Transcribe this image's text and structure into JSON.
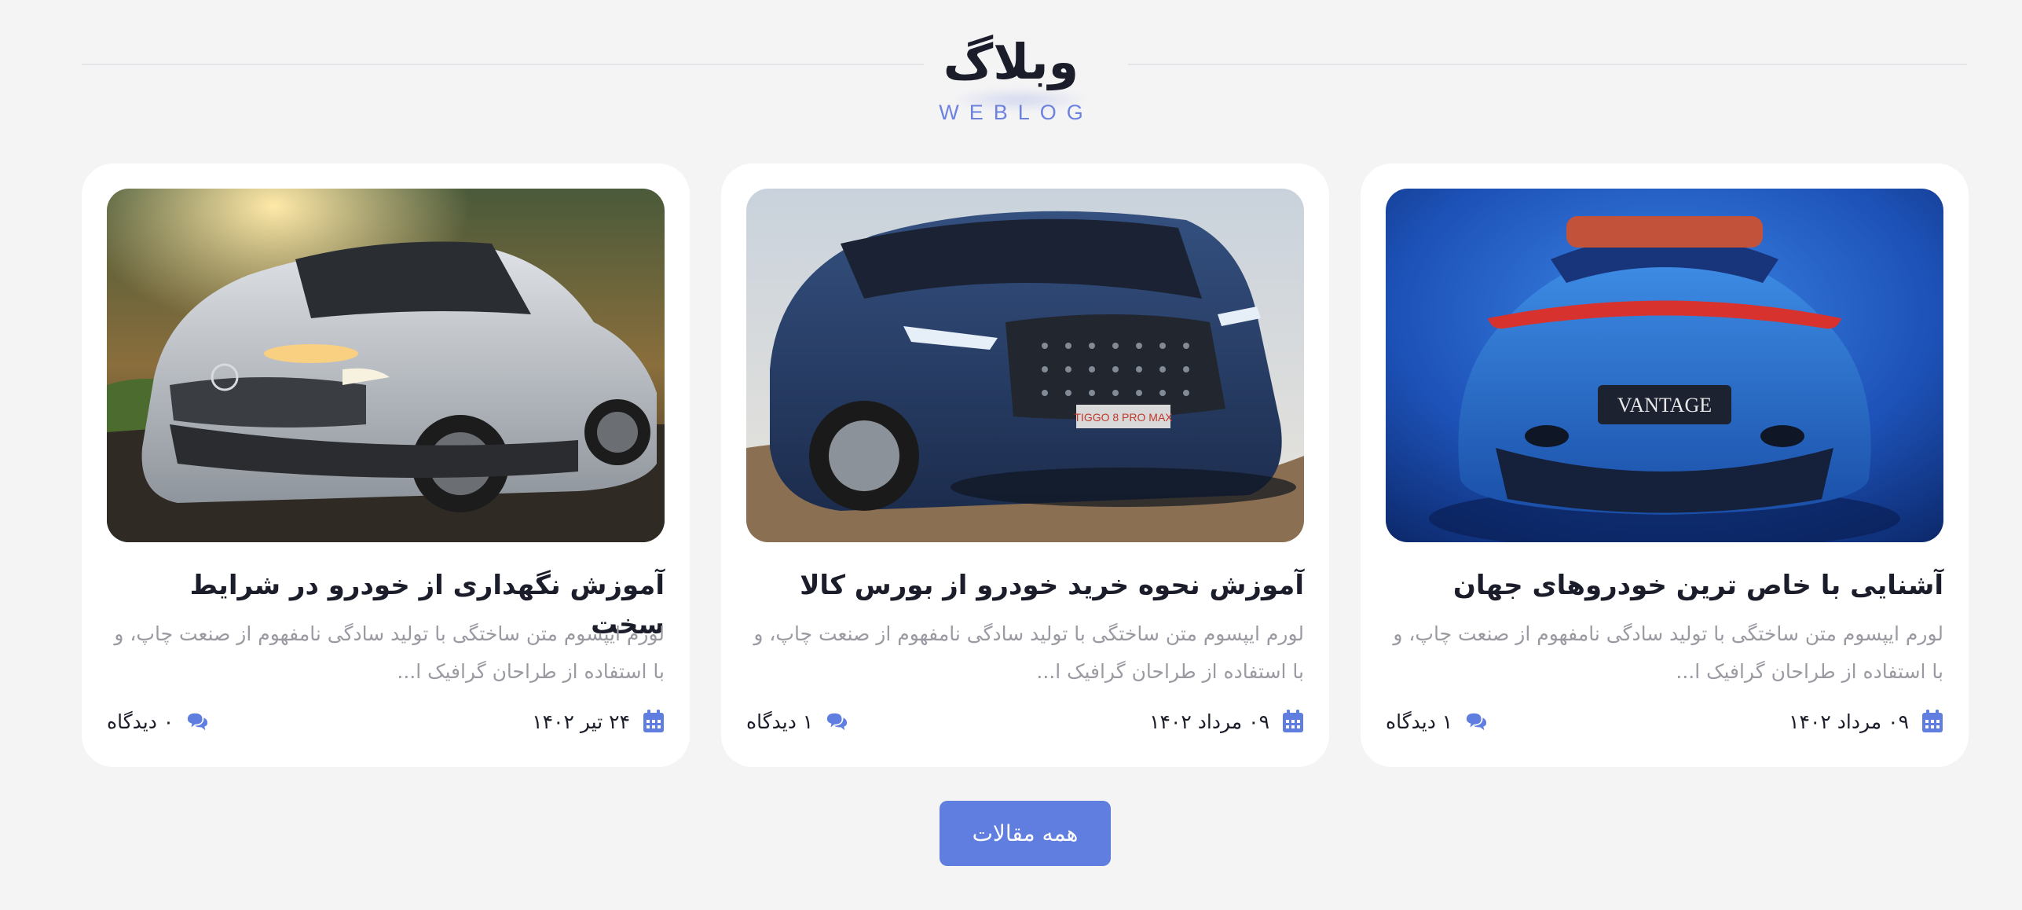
{
  "section": {
    "title": "وبلاگ",
    "subtitle": "WEBLOG",
    "accent_color": "#5f7ee0"
  },
  "posts": [
    {
      "image_alt": "Blue Aston Martin Vantage convertible rear view",
      "title": "آشنایی با خاص ترین خودروهای جهان",
      "excerpt": "لورم ایپسوم متن ساختگی با تولید سادگی نامفهوم از صنعت چاپ، و با استفاده از طراحان گرافیک ا...",
      "date": "۰۹ مرداد ۱۴۰۲",
      "comments": "۱ دیدگاه",
      "date_icon": "calendar-icon",
      "comments_icon": "comments-icon"
    },
    {
      "image_alt": "Dark blue Chery Tiggo 8 Pro Max SUV front view",
      "title": "آموزش نحوه خرید خودرو از بورس کالا",
      "excerpt": "لورم ایپسوم متن ساختگی با تولید سادگی نامفهوم از صنعت چاپ، و با استفاده از طراحان گرافیک ا...",
      "date": "۰۹ مرداد ۱۴۰۲",
      "comments": "۱ دیدگاه",
      "date_icon": "calendar-icon",
      "comments_icon": "comments-icon"
    },
    {
      "image_alt": "Silver Mazda MX-30 driving at sunset",
      "title": "آموزش نگهداری از خودرو در شرایط سخت",
      "excerpt": "لورم ایپسوم متن ساختگی با تولید سادگی نامفهوم از صنعت چاپ، و با استفاده از طراحان گرافیک ا...",
      "date": "۲۴ تیر ۱۴۰۲",
      "comments": "۰ دیدگاه",
      "date_icon": "calendar-icon",
      "comments_icon": "comments-icon"
    }
  ],
  "button": {
    "label": "همه مقالات"
  }
}
